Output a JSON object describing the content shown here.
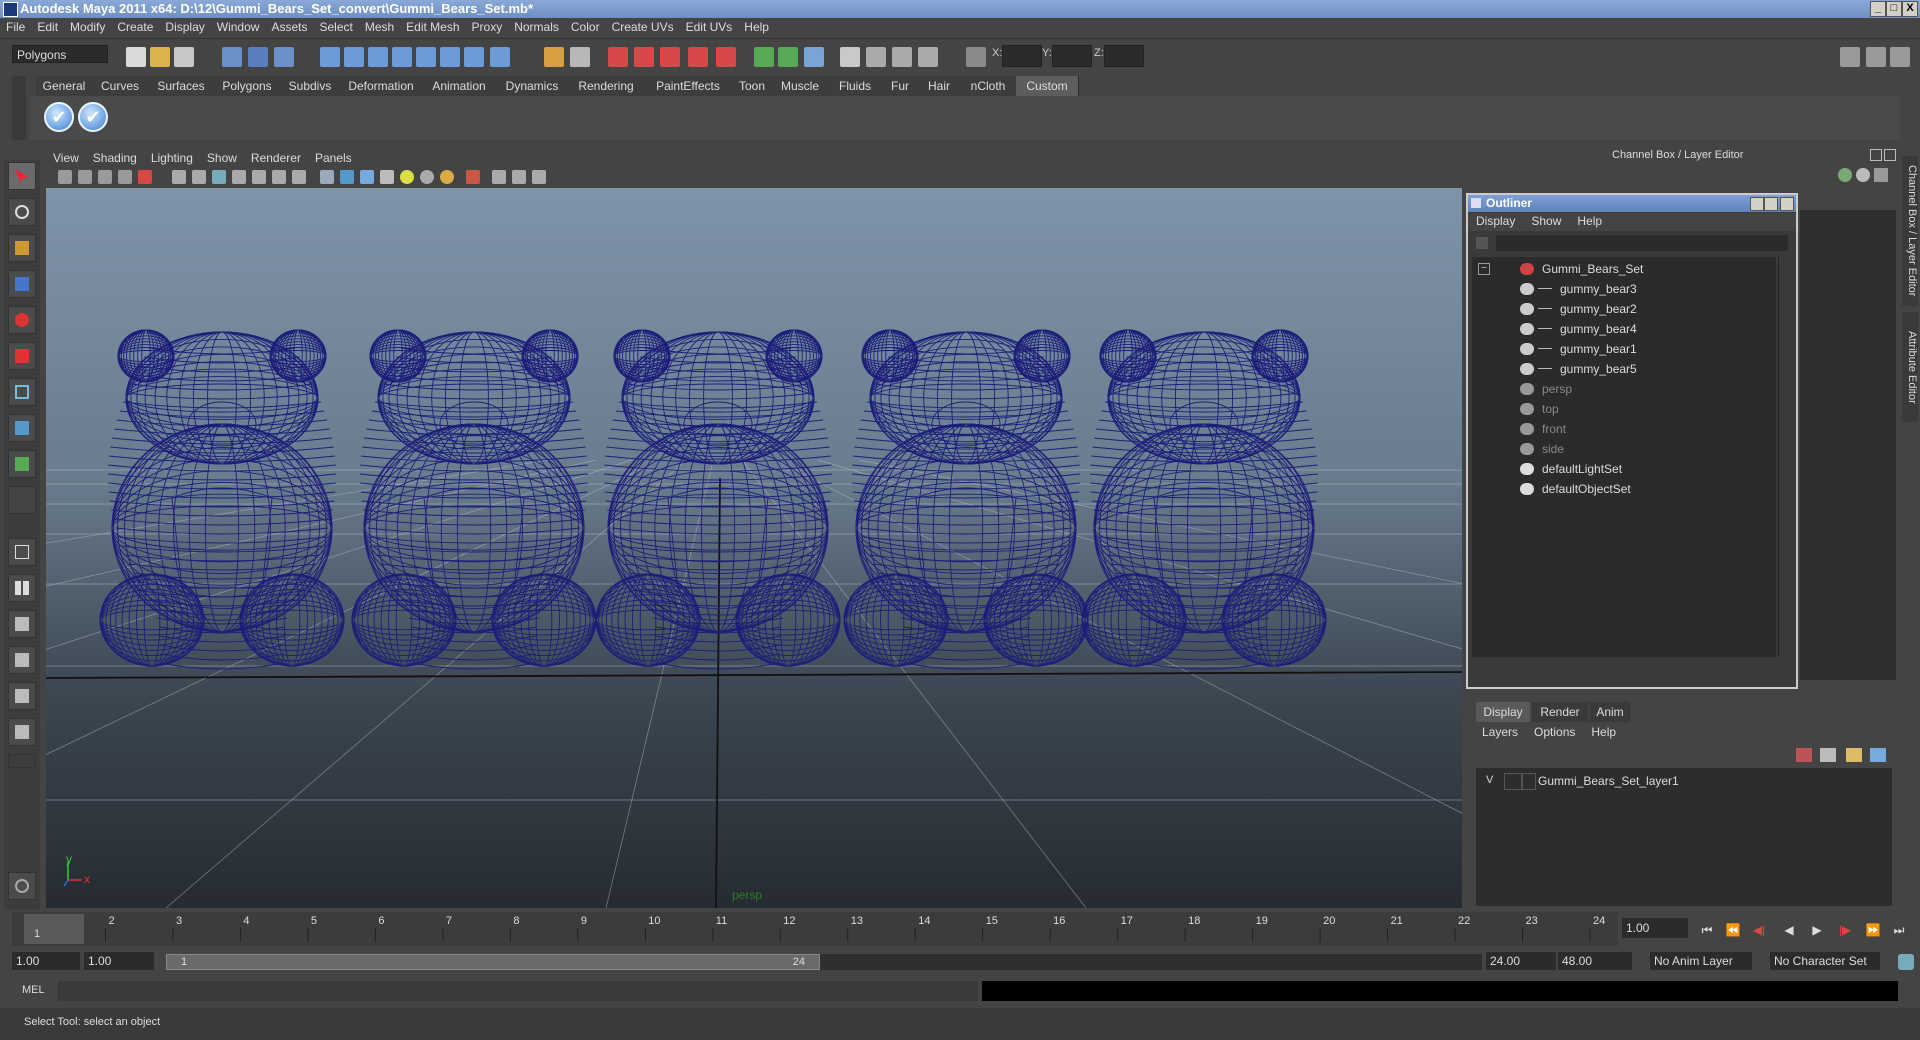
{
  "window": {
    "title": "Autodesk Maya 2011 x64: D:\\12\\Gummi_Bears_Set_convert\\Gummi_Bears_Set.mb*",
    "min": "_",
    "max": "□",
    "close": "X"
  },
  "menubar": [
    "File",
    "Edit",
    "Modify",
    "Create",
    "Display",
    "Window",
    "Assets",
    "Select",
    "Mesh",
    "Edit Mesh",
    "Proxy",
    "Normals",
    "Color",
    "Create UVs",
    "Edit UVs",
    "Help"
  ],
  "statusline": {
    "mode": "Polygons",
    "x_label": "X:",
    "y_label": "Y:",
    "z_label": "Z:"
  },
  "shelf": {
    "tabs": [
      "General",
      "Curves",
      "Surfaces",
      "Polygons",
      "Subdivs",
      "Deformation",
      "Animation",
      "Dynamics",
      "Rendering",
      "PaintEffects",
      "Toon",
      "Muscle",
      "Fluids",
      "Fur",
      "Hair",
      "nCloth",
      "Custom"
    ],
    "active_tab": "Custom",
    "check": "✔"
  },
  "viewport": {
    "menu": [
      "View",
      "Shading",
      "Lighting",
      "Show",
      "Renderer",
      "Panels"
    ],
    "camera_label": "persp",
    "axis_y": "y",
    "axis_x": "x"
  },
  "channel_box": {
    "title": "Channel Box / Layer Editor",
    "side_tab_1": "Channel Box / Layer Editor",
    "side_tab_2": "Attribute Editor"
  },
  "outliner": {
    "title": "Outliner",
    "menu": [
      "Display",
      "Show",
      "Help"
    ],
    "collapse_glyph": "−",
    "items": [
      {
        "label": "Gummi_Bears_Set",
        "indent": 0,
        "dim": false,
        "kind": "set"
      },
      {
        "label": "gummy_bear3",
        "indent": 1,
        "dim": false,
        "kind": "mesh"
      },
      {
        "label": "gummy_bear2",
        "indent": 1,
        "dim": false,
        "kind": "mesh"
      },
      {
        "label": "gummy_bear4",
        "indent": 1,
        "dim": false,
        "kind": "mesh"
      },
      {
        "label": "gummy_bear1",
        "indent": 1,
        "dim": false,
        "kind": "mesh"
      },
      {
        "label": "gummy_bear5",
        "indent": 1,
        "dim": false,
        "kind": "mesh"
      },
      {
        "label": "persp",
        "indent": 0,
        "dim": true,
        "kind": "camera"
      },
      {
        "label": "top",
        "indent": 0,
        "dim": true,
        "kind": "camera"
      },
      {
        "label": "front",
        "indent": 0,
        "dim": true,
        "kind": "camera"
      },
      {
        "label": "side",
        "indent": 0,
        "dim": true,
        "kind": "camera"
      },
      {
        "label": "defaultLightSet",
        "indent": 0,
        "dim": false,
        "kind": "objset"
      },
      {
        "label": "defaultObjectSet",
        "indent": 0,
        "dim": false,
        "kind": "objset"
      }
    ]
  },
  "layer_editor": {
    "tabs": [
      "Display",
      "Render",
      "Anim"
    ],
    "active_tab": "Display",
    "menu": [
      "Layers",
      "Options",
      "Help"
    ],
    "layer_visible": "V",
    "layer_name": "Gummi_Bears_Set_layer1"
  },
  "timeline": {
    "ticks": [
      "1",
      "2",
      "3",
      "4",
      "5",
      "6",
      "7",
      "8",
      "9",
      "10",
      "11",
      "12",
      "13",
      "14",
      "15",
      "16",
      "17",
      "18",
      "19",
      "20",
      "21",
      "22",
      "23",
      "24"
    ],
    "current_marker": "1",
    "current_frame": "1.00",
    "playback": [
      "⏮",
      "⏪",
      "◀|",
      "◀",
      "▶",
      "|▶",
      "⏩",
      "⏭"
    ]
  },
  "range": {
    "start": "1.00",
    "start_inner": "1.00",
    "handle_start": "1",
    "handle_end": "24",
    "end_inner": "24.00",
    "end": "48.00",
    "anim_layer": "No Anim Layer",
    "char_set": "No Character Set"
  },
  "command_line": {
    "label": "MEL"
  },
  "help_line": {
    "text": "Select Tool: select an object"
  },
  "colors": {
    "wire": "#1c1f7a",
    "grid": "#bfc6cc",
    "accent": "#5f83bd"
  }
}
